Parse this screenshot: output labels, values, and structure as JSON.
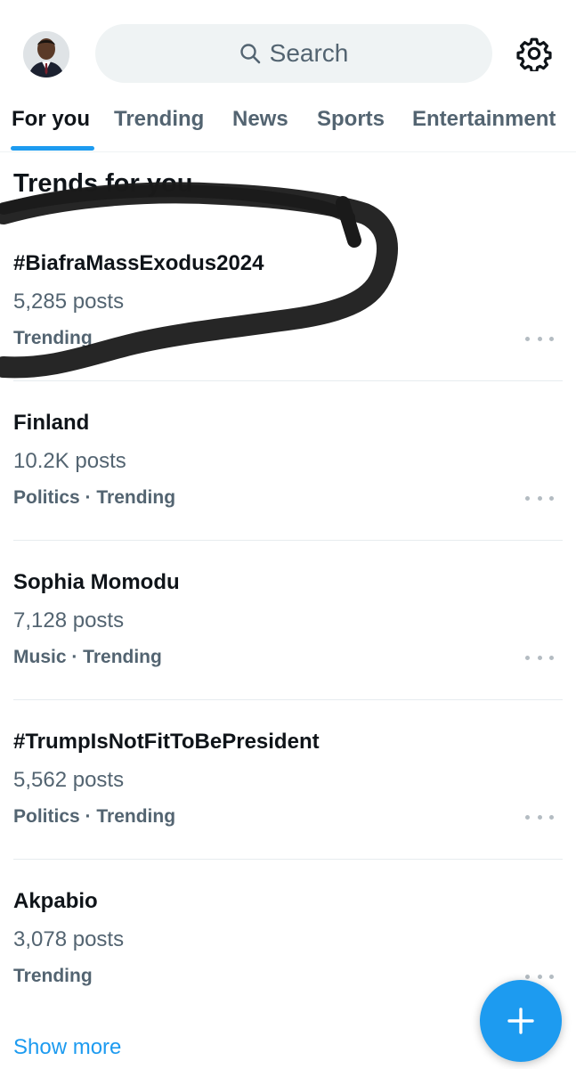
{
  "search": {
    "placeholder": "Search"
  },
  "tabs": [
    {
      "label": "For you",
      "active": true
    },
    {
      "label": "Trending",
      "active": false
    },
    {
      "label": "News",
      "active": false
    },
    {
      "label": "Sports",
      "active": false
    },
    {
      "label": "Entertainment",
      "active": false
    }
  ],
  "section_title": "Trends for you",
  "trends": [
    {
      "name": "#BiafraMassExodus2024",
      "posts": "5,285 posts",
      "meta": "Trending"
    },
    {
      "name": "Finland",
      "posts": "10.2K posts",
      "meta": "Politics · Trending"
    },
    {
      "name": "Sophia Momodu",
      "posts": "7,128 posts",
      "meta": "Music · Trending"
    },
    {
      "name": "#TrumpIsNotFitToBePresident",
      "posts": "5,562 posts",
      "meta": "Politics · Trending"
    },
    {
      "name": "Akpabio",
      "posts": "3,078 posts",
      "meta": "Trending"
    }
  ],
  "show_more": "Show more",
  "icons": {
    "avatar": "profile-avatar",
    "search": "search-icon",
    "settings": "gear-icon",
    "more": "more-horizontal-icon",
    "compose": "plus-icon"
  },
  "colors": {
    "accent": "#1d9bf0",
    "secondary_text": "#536471",
    "annotation": "#1a1a1a"
  }
}
